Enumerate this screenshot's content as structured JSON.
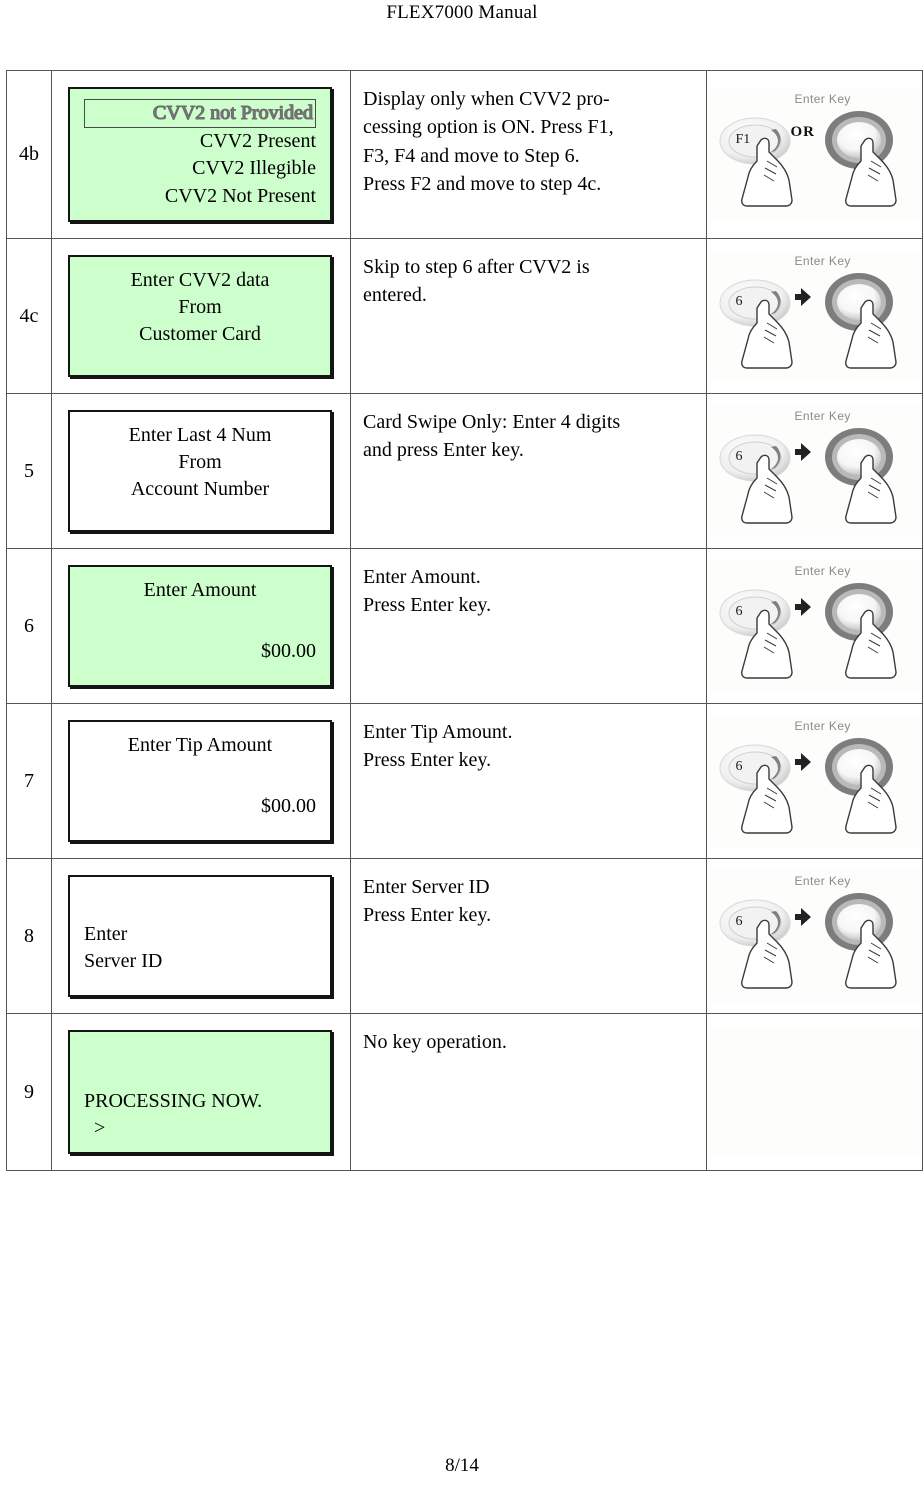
{
  "document": {
    "header_title": "FLEX7000 Manual",
    "page_number": "8/14"
  },
  "theme": {
    "lcd_green": "#CCFFCC",
    "lcd_white": "#FFFFFF",
    "border": "#141414",
    "table_border": "#555555"
  },
  "key_art": {
    "enter_key_label": "Enter Key",
    "or_label": "OR",
    "f1_key_label": "F1",
    "digit_key_label": "6"
  },
  "rows": [
    {
      "step": "4b",
      "screen": {
        "background": "#CCFFCC",
        "height": "tall",
        "lines": [
          {
            "text": "CVV2 not Provided",
            "align": "right",
            "style": "selected"
          },
          {
            "text": "CVV2 Present",
            "align": "right",
            "style": "normal"
          },
          {
            "text": "CVV2 Illegible",
            "align": "right",
            "style": "normal"
          },
          {
            "text": "CVV2 Not Present",
            "align": "right",
            "style": "normal"
          }
        ]
      },
      "description": "Display only when CVV2 pro-\ncessing option is ON. Press F1,\nF3, F4 and move to Step 6.\nPress F2 and move to step 4c.",
      "key_art": "f1-or-enter"
    },
    {
      "step": "4c",
      "screen": {
        "background": "#CCFFCC",
        "height": "mid",
        "lines": [
          {
            "text": "Enter CVV2 data",
            "align": "center",
            "style": "normal"
          },
          {
            "text": "From",
            "align": "center",
            "style": "normal"
          },
          {
            "text": "Customer Card",
            "align": "center",
            "style": "normal"
          }
        ]
      },
      "description": "Skip to step 6 after CVV2 is\nentered.",
      "key_art": "digit-then-enter"
    },
    {
      "step": "5",
      "screen": {
        "background": "#FFFFFF",
        "height": "mid",
        "lines": [
          {
            "text": "Enter Last 4 Num",
            "align": "center",
            "style": "normal"
          },
          {
            "text": "From",
            "align": "center",
            "style": "normal"
          },
          {
            "text": "Account Number",
            "align": "center",
            "style": "normal"
          }
        ]
      },
      "description": "Card Swipe Only: Enter 4 digits\nand press Enter key.",
      "key_art": "digit-then-enter"
    },
    {
      "step": "6",
      "screen": {
        "background": "#CCFFCC",
        "height": "mid",
        "lines": [
          {
            "text": "Enter Amount",
            "align": "center",
            "style": "normal"
          },
          {
            "text": "",
            "align": "center",
            "style": "spacer"
          },
          {
            "text": "$00.00",
            "align": "right",
            "style": "normal"
          }
        ]
      },
      "description": "Enter Amount.\nPress Enter key.",
      "key_art": "digit-then-enter"
    },
    {
      "step": "7",
      "screen": {
        "background": "#FFFFFF",
        "height": "mid",
        "lines": [
          {
            "text": "Enter Tip Amount",
            "align": "center",
            "style": "normal"
          },
          {
            "text": "",
            "align": "center",
            "style": "spacer"
          },
          {
            "text": "$00.00",
            "align": "right",
            "style": "normal"
          }
        ]
      },
      "description": "Enter Tip Amount.\nPress Enter key.",
      "key_art": "digit-then-enter"
    },
    {
      "step": "8",
      "screen": {
        "background": "#FFFFFF",
        "height": "mid",
        "lines": [
          {
            "text": "",
            "align": "left",
            "style": "spacer"
          },
          {
            "text": "Enter",
            "align": "left",
            "style": "normal"
          },
          {
            "text": "Server ID",
            "align": "left",
            "style": "normal"
          }
        ]
      },
      "description": "Enter Server ID\nPress Enter key.",
      "key_art": "digit-then-enter"
    },
    {
      "step": "9",
      "screen": {
        "background": "#CCFFCC",
        "height": "mid",
        "lines": [
          {
            "text": "",
            "align": "left",
            "style": "spacer-lg"
          },
          {
            "text": "PROCESSING NOW.",
            "align": "left",
            "style": "normal"
          },
          {
            "text": "  >",
            "align": "left",
            "style": "normal"
          }
        ]
      },
      "description": "No key operation.",
      "key_art": "none"
    }
  ]
}
